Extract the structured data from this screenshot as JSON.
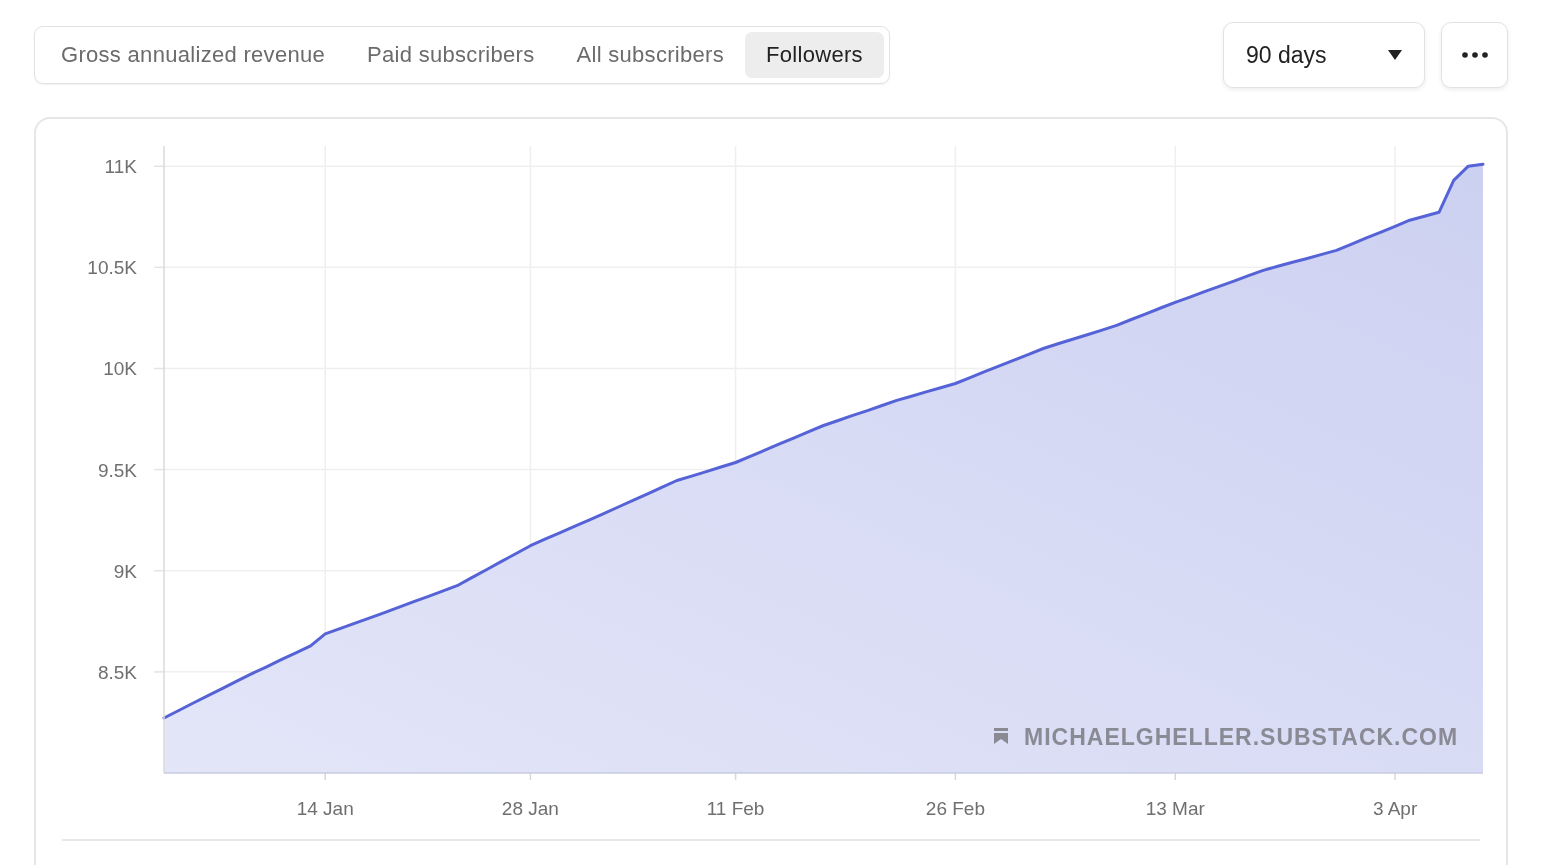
{
  "tabs": [
    {
      "label": "Gross annualized revenue",
      "selected": false
    },
    {
      "label": "Paid subscribers",
      "selected": false
    },
    {
      "label": "All subscribers",
      "selected": false
    },
    {
      "label": "Followers",
      "selected": true
    }
  ],
  "range_dropdown": {
    "value": "90 days"
  },
  "chart": {
    "site_label": "MICHAELGHELLER.SUBSTACK.COM",
    "chart_data": {
      "type": "area",
      "categories": [
        null,
        null,
        null,
        null,
        null,
        null,
        null,
        null,
        null,
        null,
        null,
        "14 Jan",
        null,
        null,
        null,
        null,
        null,
        null,
        null,
        null,
        null,
        null,
        null,
        null,
        null,
        "28 Jan",
        null,
        null,
        null,
        null,
        null,
        null,
        null,
        null,
        null,
        null,
        null,
        null,
        null,
        "11 Feb",
        null,
        null,
        null,
        null,
        null,
        null,
        null,
        null,
        null,
        null,
        null,
        null,
        null,
        null,
        "26 Feb",
        null,
        null,
        null,
        null,
        null,
        null,
        null,
        null,
        null,
        null,
        null,
        null,
        null,
        null,
        "13 Mar",
        null,
        null,
        null,
        null,
        null,
        null,
        null,
        null,
        null,
        null,
        null,
        null,
        null,
        null,
        "3 Apr",
        null,
        null,
        null,
        null,
        null,
        null
      ],
      "series": [
        {
          "color": "#5563d6",
          "values": [
            8272,
            8309,
            8346,
            8382,
            8419,
            8456,
            8491,
            8525,
            8560,
            8594,
            8629,
            8688,
            8714,
            8740,
            8766,
            8792,
            8819,
            8846,
            8872,
            8899,
            8926,
            8966,
            9005,
            9045,
            9084,
            9124,
            9156,
            9187,
            9219,
            9250,
            9282,
            9315,
            9348,
            9380,
            9413,
            9446,
            9468,
            9490,
            9513,
            9535,
            9566,
            9596,
            9627,
            9657,
            9688,
            9718,
            9743,
            9768,
            9792,
            9817,
            9842,
            9863,
            9884,
            9905,
            9926,
            9955,
            9984,
            10013,
            10041,
            10070,
            10099,
            10122,
            10145,
            10167,
            10190,
            10213,
            10242,
            10270,
            10299,
            10327,
            10353,
            10380,
            10406,
            10432,
            10459,
            10485,
            10505,
            10525,
            10544,
            10564,
            10584,
            10614,
            10644,
            10673,
            10703,
            10733,
            10753,
            10772,
            10930,
            11000,
            11010
          ]
        }
      ],
      "ylim": [
        8000,
        11100
      ],
      "grid": true,
      "yticks": [
        {
          "value": 8500,
          "label": "8.5K"
        },
        {
          "value": 9000,
          "label": "9K"
        },
        {
          "value": 9500,
          "label": "9.5K"
        },
        {
          "value": 10000,
          "label": "10K"
        },
        {
          "value": 10500,
          "label": "10.5K"
        },
        {
          "value": 11000,
          "label": "11K"
        }
      ]
    }
  }
}
